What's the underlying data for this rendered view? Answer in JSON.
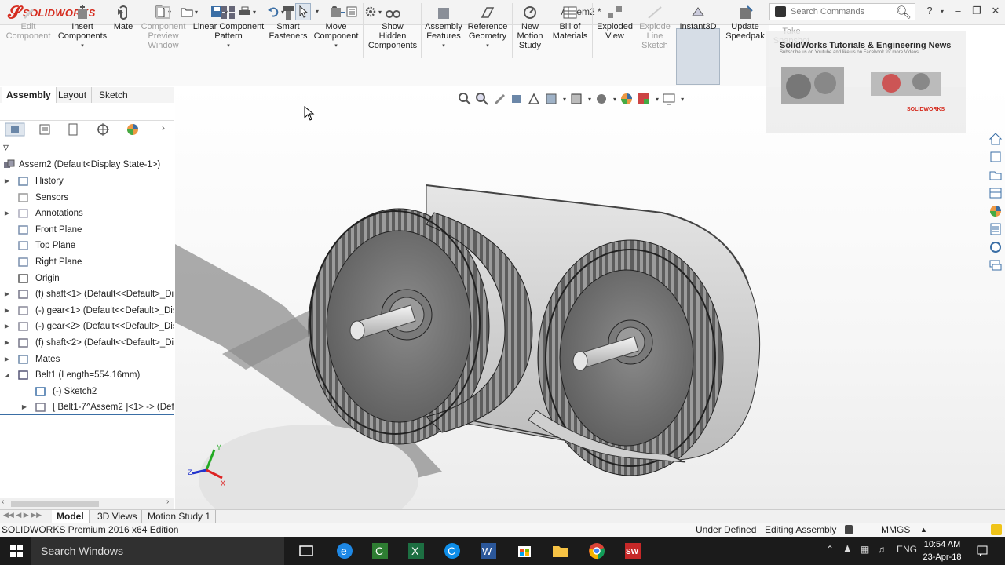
{
  "app": {
    "logo_text": "SOLIDWORKS",
    "title": "Assem2 *",
    "search_placeholder": "Search Commands",
    "help_label": "?"
  },
  "command_manager": {
    "items": [
      {
        "label": "Edit Component",
        "enabled": false
      },
      {
        "label": "Insert Components",
        "enabled": true
      },
      {
        "label": "Mate",
        "enabled": true
      },
      {
        "label": "Component Preview Window",
        "enabled": false
      },
      {
        "label": "Linear Component Pattern",
        "enabled": true
      },
      {
        "label": "Smart Fasteners",
        "enabled": true
      },
      {
        "label": "Move Component",
        "enabled": true
      },
      {
        "label": "Show Hidden Components",
        "enabled": true
      },
      {
        "label": "Assembly Features",
        "enabled": true
      },
      {
        "label": "Reference Geometry",
        "enabled": true
      },
      {
        "label": "New Motion Study",
        "enabled": true
      },
      {
        "label": "Bill of Materials",
        "enabled": true
      },
      {
        "label": "Exploded View",
        "enabled": true
      },
      {
        "label": "Explode Line Sketch",
        "enabled": false
      },
      {
        "label": "Instant3D",
        "enabled": true,
        "active": true
      },
      {
        "label": "Update Speedpak",
        "enabled": true
      },
      {
        "label": "Take Snapshot",
        "enabled": false
      }
    ],
    "tabs": [
      "Assembly",
      "Layout",
      "Sketch"
    ],
    "active_tab": "Assembly"
  },
  "feature_tree": {
    "root": "Assem2  (Default<Display State-1>)",
    "items": [
      {
        "label": "History",
        "expandable": true
      },
      {
        "label": "Sensors",
        "expandable": false
      },
      {
        "label": "Annotations",
        "expandable": true
      },
      {
        "label": "Front Plane",
        "expandable": false
      },
      {
        "label": "Top Plane",
        "expandable": false
      },
      {
        "label": "Right Plane",
        "expandable": false
      },
      {
        "label": "Origin",
        "expandable": false
      },
      {
        "label": "(f) shaft<1> (Default<<Default>_Di",
        "expandable": true
      },
      {
        "label": "(-) gear<1> (Default<<Default>_Dis",
        "expandable": true
      },
      {
        "label": "(-) gear<2> (Default<<Default>_Dis",
        "expandable": true
      },
      {
        "label": "(f) shaft<2> (Default<<Default>_Di",
        "expandable": true
      },
      {
        "label": "Mates",
        "expandable": true
      },
      {
        "label": "Belt1 (Length=554.16mm)",
        "expandable": true,
        "expanded": true
      },
      {
        "label": "(-) Sketch2",
        "expandable": false,
        "child": true
      },
      {
        "label": "[ Belt1-7^Assem2 ]<1> -> (Def",
        "expandable": true,
        "child": true
      }
    ]
  },
  "viewport": {
    "ad_title": "SolidWorks Tutorials & Engineering News",
    "ad_subtitle": "Subscribe us on Youtube and like us on Facebook for more Videos",
    "ad_brand": "SOLIDWORKS",
    "triad_x": "X",
    "triad_y": "Y",
    "triad_z": "Z"
  },
  "bottom_tabs": [
    "Model",
    "3D Views",
    "Motion Study 1"
  ],
  "status_bar": {
    "edition": "SOLIDWORKS Premium 2016 x64 Edition",
    "state": "Under Defined",
    "mode": "Editing Assembly",
    "units": "MMGS"
  },
  "taskbar": {
    "search": "Search Windows",
    "lang": "ENG",
    "time": "10:54 AM",
    "date": "23-Apr-18"
  },
  "colors": {
    "brand": "#d52b1e",
    "part_gray": "#9a9a9a",
    "part_dark": "#6e6e6e",
    "active_tab": "#ffffff"
  }
}
